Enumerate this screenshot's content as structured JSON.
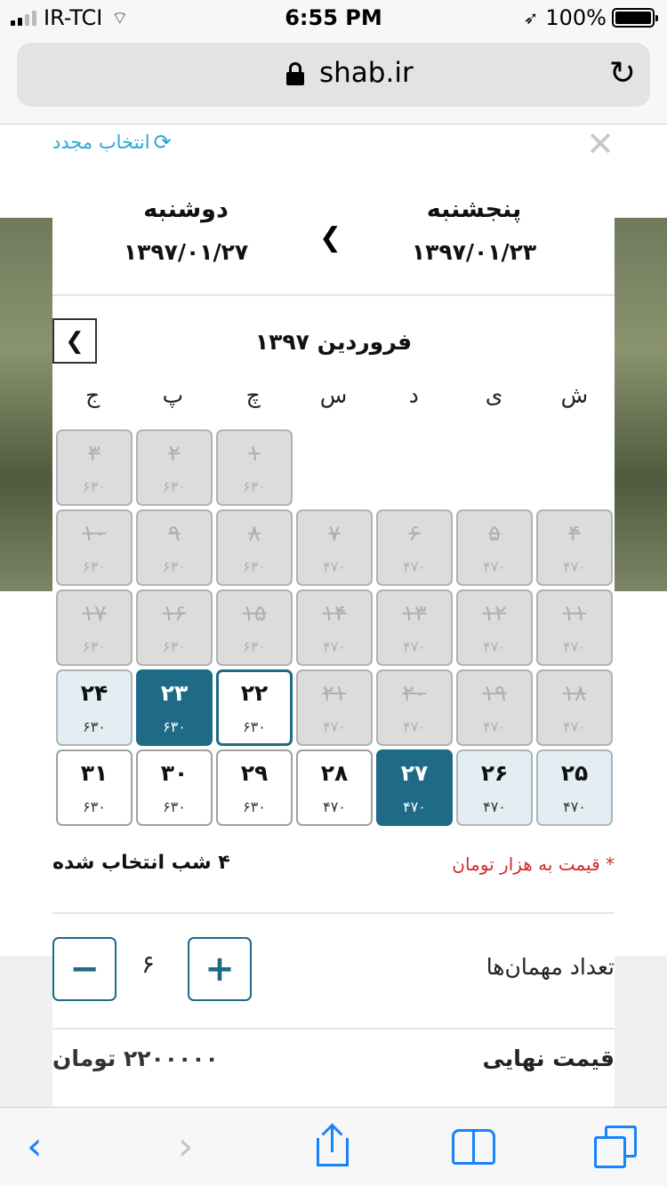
{
  "status_bar": {
    "carrier": "IR-TCI",
    "time": "6:55 PM",
    "battery": "100%"
  },
  "browser": {
    "url": "shab.ir"
  },
  "booking": {
    "reselect_label": "انتخاب مجدد",
    "checkin": {
      "day": "پنجشنبه",
      "date": "۱۳۹۷/۰۱/۲۳"
    },
    "checkout": {
      "day": "دوشنبه",
      "date": "۱۳۹۷/۰۱/۲۷"
    },
    "month_title": "فروردین ۱۳۹۷",
    "weekdays": [
      "ش",
      "ی",
      "د",
      "س",
      "چ",
      "پ",
      "ج"
    ],
    "calendar": [
      {
        "type": "empty"
      },
      {
        "type": "empty"
      },
      {
        "type": "empty"
      },
      {
        "type": "empty"
      },
      {
        "num": "۱",
        "price": "۶۳۰",
        "state": "past"
      },
      {
        "num": "۲",
        "price": "۶۳۰",
        "state": "past"
      },
      {
        "num": "۳",
        "price": "۶۳۰",
        "state": "past"
      },
      {
        "num": "۴",
        "price": "۴۷۰",
        "state": "past"
      },
      {
        "num": "۵",
        "price": "۴۷۰",
        "state": "past"
      },
      {
        "num": "۶",
        "price": "۴۷۰",
        "state": "past"
      },
      {
        "num": "۷",
        "price": "۴۷۰",
        "state": "past"
      },
      {
        "num": "۸",
        "price": "۶۳۰",
        "state": "past"
      },
      {
        "num": "۹",
        "price": "۶۳۰",
        "state": "past"
      },
      {
        "num": "۱۰",
        "price": "۶۳۰",
        "state": "past"
      },
      {
        "num": "۱۱",
        "price": "۴۷۰",
        "state": "past"
      },
      {
        "num": "۱۲",
        "price": "۴۷۰",
        "state": "past"
      },
      {
        "num": "۱۳",
        "price": "۴۷۰",
        "state": "past"
      },
      {
        "num": "۱۴",
        "price": "۴۷۰",
        "state": "past"
      },
      {
        "num": "۱۵",
        "price": "۶۳۰",
        "state": "past"
      },
      {
        "num": "۱۶",
        "price": "۶۳۰",
        "state": "past"
      },
      {
        "num": "۱۷",
        "price": "۶۳۰",
        "state": "past"
      },
      {
        "num": "۱۸",
        "price": "۴۷۰",
        "state": "past"
      },
      {
        "num": "۱۹",
        "price": "۴۷۰",
        "state": "past"
      },
      {
        "num": "۲۰",
        "price": "۴۷۰",
        "state": "past"
      },
      {
        "num": "۲۱",
        "price": "۴۷۰",
        "state": "past"
      },
      {
        "num": "۲۲",
        "price": "۶۳۰",
        "state": "today"
      },
      {
        "num": "۲۳",
        "price": "۶۳۰",
        "state": "selected"
      },
      {
        "num": "۲۴",
        "price": "۶۳۰",
        "state": "range"
      },
      {
        "num": "۲۵",
        "price": "۴۷۰",
        "state": "range"
      },
      {
        "num": "۲۶",
        "price": "۴۷۰",
        "state": "range"
      },
      {
        "num": "۲۷",
        "price": "۴۷۰",
        "state": "selected"
      },
      {
        "num": "۲۸",
        "price": "۴۷۰",
        "state": "free"
      },
      {
        "num": "۲۹",
        "price": "۶۳۰",
        "state": "free"
      },
      {
        "num": "۳۰",
        "price": "۶۳۰",
        "state": "free"
      },
      {
        "num": "۳۱",
        "price": "۶۳۰",
        "state": "free"
      }
    ],
    "price_note": "* قیمت به هزار تومان",
    "nights_selected": "۴ شب انتخاب شده",
    "guests_label": "تعداد مهمان‌ها",
    "guest_count": "۶",
    "final_price_label": "قیمت نهایی",
    "final_price_value": "۲۲۰۰۰۰۰ تومان"
  },
  "colors": {
    "accent": "#1f6a86",
    "link": "#2aa6d6",
    "note_red": "#cf2b2b",
    "ios_blue": "#1a82fb"
  }
}
